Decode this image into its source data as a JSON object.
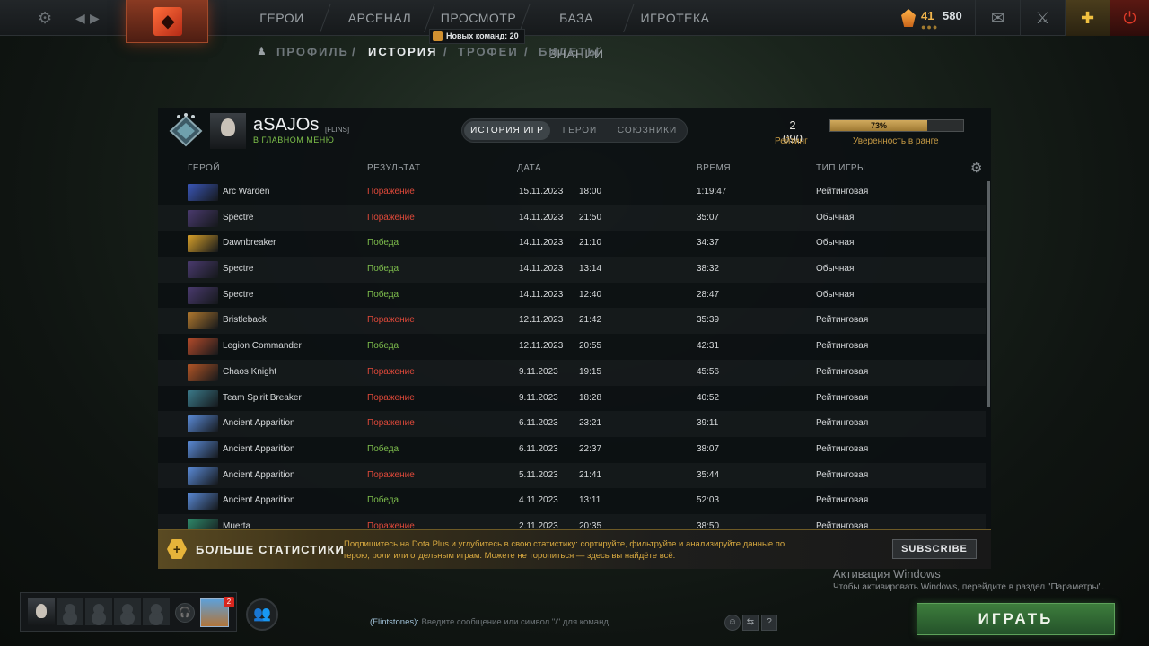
{
  "topbar": {
    "nav": [
      "ГЕРОИ",
      "АРСЕНАЛ",
      "ПРОСМОТР",
      "БАЗА ЗНАНИЙ",
      "ИГРОТЕКА"
    ],
    "currency": {
      "shards": "41",
      "second": "580",
      "dots": "●●●"
    },
    "notification": "Новых команд: 20"
  },
  "subnav": {
    "items": [
      "ПРОФИЛЬ",
      "ИСТОРИЯ",
      "ТРОФЕИ",
      "БИЛЕТЫ"
    ],
    "separator": "/"
  },
  "profile": {
    "name": "aSAJOs",
    "tag": "[FLINS]",
    "status": "В ГЛАВНОМ МЕНЮ",
    "tabs": [
      "ИСТОРИЯ ИГР",
      "ГЕРОИ",
      "СОЮЗНИКИ"
    ],
    "rating": "2 090",
    "rating_label": "Рейтинг",
    "confidence": 0.73,
    "confidence_text": "73%",
    "confidence_label": "Уверенность в ранге"
  },
  "table": {
    "headers": [
      "ГЕРОЙ",
      "РЕЗУЛЬТАТ",
      "ДАТА",
      "ВРЕМЯ",
      "ТИП ИГРЫ"
    ],
    "rows": [
      {
        "hero": "Arc Warden",
        "result": "Поражение",
        "win": false,
        "date": "15.11.2023",
        "time": "18:00",
        "duration": "1:19:47",
        "type": "Рейтинговая",
        "color": "#3a56b8"
      },
      {
        "hero": "Spectre",
        "result": "Поражение",
        "win": false,
        "date": "14.11.2023",
        "time": "21:50",
        "duration": "35:07",
        "type": "Обычная",
        "color": "#4a3a6e"
      },
      {
        "hero": "Dawnbreaker",
        "result": "Победа",
        "win": true,
        "date": "14.11.2023",
        "time": "21:10",
        "duration": "34:37",
        "type": "Обычная",
        "color": "#d8a12a"
      },
      {
        "hero": "Spectre",
        "result": "Победа",
        "win": true,
        "date": "14.11.2023",
        "time": "13:14",
        "duration": "38:32",
        "type": "Обычная",
        "color": "#4a3a6e"
      },
      {
        "hero": "Spectre",
        "result": "Победа",
        "win": true,
        "date": "14.11.2023",
        "time": "12:40",
        "duration": "28:47",
        "type": "Обычная",
        "color": "#4a3a6e"
      },
      {
        "hero": "Bristleback",
        "result": "Поражение",
        "win": false,
        "date": "12.11.2023",
        "time": "21:42",
        "duration": "35:39",
        "type": "Рейтинговая",
        "color": "#b0782e"
      },
      {
        "hero": "Legion Commander",
        "result": "Победа",
        "win": true,
        "date": "12.11.2023",
        "time": "20:55",
        "duration": "42:31",
        "type": "Рейтинговая",
        "color": "#b34a2a"
      },
      {
        "hero": "Chaos Knight",
        "result": "Поражение",
        "win": false,
        "date": "9.11.2023",
        "time": "19:15",
        "duration": "45:56",
        "type": "Рейтинговая",
        "color": "#b35526"
      },
      {
        "hero": "Team Spirit Breaker",
        "result": "Поражение",
        "win": false,
        "date": "9.11.2023",
        "time": "18:28",
        "duration": "40:52",
        "type": "Рейтинговая",
        "color": "#3b7a8a"
      },
      {
        "hero": "Ancient Apparition",
        "result": "Поражение",
        "win": false,
        "date": "6.11.2023",
        "time": "23:21",
        "duration": "39:11",
        "type": "Рейтинговая",
        "color": "#5a8ad6"
      },
      {
        "hero": "Ancient Apparition",
        "result": "Победа",
        "win": true,
        "date": "6.11.2023",
        "time": "22:37",
        "duration": "38:07",
        "type": "Рейтинговая",
        "color": "#5a8ad6"
      },
      {
        "hero": "Ancient Apparition",
        "result": "Поражение",
        "win": false,
        "date": "5.11.2023",
        "time": "21:41",
        "duration": "35:44",
        "type": "Рейтинговая",
        "color": "#5a8ad6"
      },
      {
        "hero": "Ancient Apparition",
        "result": "Победа",
        "win": true,
        "date": "4.11.2023",
        "time": "13:11",
        "duration": "52:03",
        "type": "Рейтинговая",
        "color": "#5a8ad6"
      },
      {
        "hero": "Muerta",
        "result": "Поражение",
        "win": false,
        "date": "2.11.2023",
        "time": "20:35",
        "duration": "38:50",
        "type": "Рейтинговая",
        "color": "#2f8a6a"
      }
    ]
  },
  "promo": {
    "title": "БОЛЬШЕ СТАТИСТИКИ",
    "text": "Подпишитесь на Dota Plus и углубитесь в свою статистику: сортируйте, фильтруйте и анализируйте данные по герою, роли или отдельным играм. Можете не торопиться — здесь вы найдёте всё.",
    "button": "SUBSCRIBE"
  },
  "watermark": {
    "title": "Активация Windows",
    "text": "Чтобы активировать Windows, перейдите в раздел \"Параметры\"."
  },
  "party": {
    "roster_badge": "2"
  },
  "chat": {
    "channel": "(Flintstones):",
    "placeholder": "Введите сообщение или символ \"/\" для команд."
  },
  "play_button": "ИГРАТЬ"
}
